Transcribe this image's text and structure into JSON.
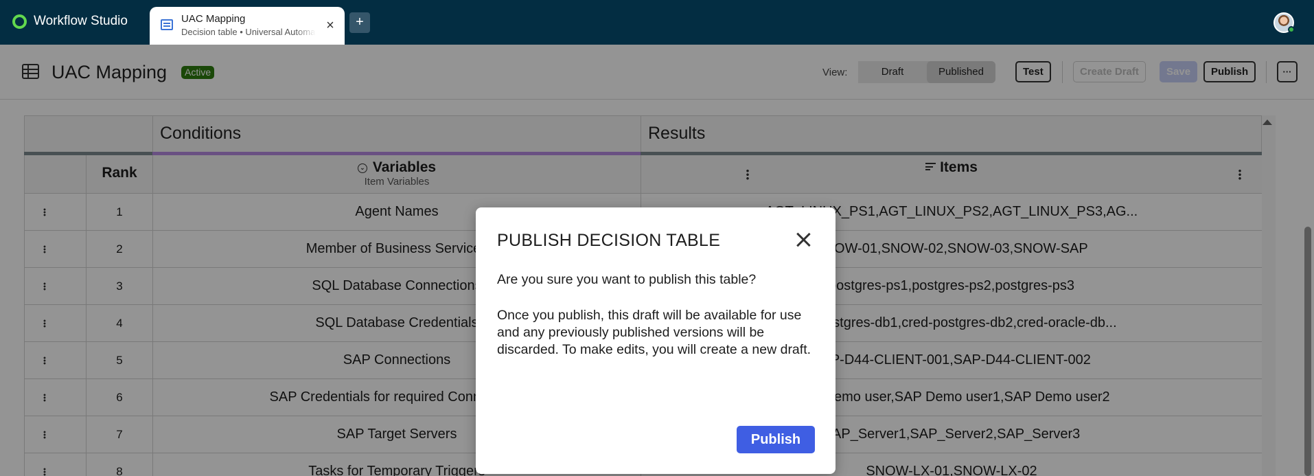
{
  "app": {
    "name": "Workflow Studio"
  },
  "tab": {
    "title": "UAC Mapping",
    "subtitle": "Decision table • Universal Automation",
    "close_icon": "×",
    "new_tab_label": "+"
  },
  "header": {
    "title": "UAC Mapping",
    "status_badge": "Active",
    "view_label": "View:",
    "view_options": [
      "Draft",
      "Published"
    ],
    "selected_view": "Published",
    "buttons": {
      "test": "Test",
      "create_draft": "Create Draft",
      "save": "Save",
      "publish": "Publish",
      "more": "···"
    }
  },
  "table": {
    "group_headers": {
      "conditions": "Conditions",
      "results": "Results"
    },
    "columns": {
      "rank": "Rank",
      "variables": {
        "label": "Variables",
        "sub": "Item Variables"
      },
      "items": {
        "label": "Items"
      }
    },
    "rows": [
      {
        "rank": "1",
        "variable": "Agent Names",
        "items": "AGT_LINUX_PS1,AGT_LINUX_PS2,AGT_LINUX_PS3,AG..."
      },
      {
        "rank": "2",
        "variable": "Member of Business Services",
        "items": "SNOW-01,SNOW-02,SNOW-03,SNOW-SAP"
      },
      {
        "rank": "3",
        "variable": "SQL Database Connections",
        "items": "postgres-ps1,postgres-ps2,postgres-ps3"
      },
      {
        "rank": "4",
        "variable": "SQL Database Credentials",
        "items": "cred-postgres-db1,cred-postgres-db2,cred-oracle-db..."
      },
      {
        "rank": "5",
        "variable": "SAP Connections",
        "items": "SAP-D44-CLIENT-001,SAP-D44-CLIENT-002"
      },
      {
        "rank": "6",
        "variable": "SAP Credentials for required Connections",
        "items": "SAP Demo user,SAP Demo user1,SAP Demo user2"
      },
      {
        "rank": "7",
        "variable": "SAP Target Servers",
        "items": "SAP_Server1,SAP_Server2,SAP_Server3"
      },
      {
        "rank": "8",
        "variable": "Tasks for Temporary Triggers",
        "items": "SNOW-LX-01,SNOW-LX-02"
      }
    ]
  },
  "modal": {
    "title": "PUBLISH DECISION TABLE",
    "question": "Are you sure you want to publish this table?",
    "body": "Once you publish, this draft will be available for use and any previously published versions will be discarded. To make edits, you will create a new draft.",
    "confirm_label": "Publish"
  }
}
